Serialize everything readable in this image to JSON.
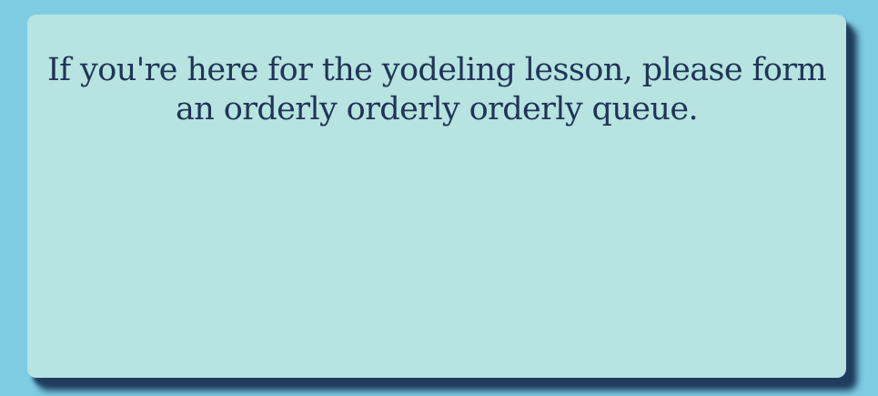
{
  "card": {
    "message": "If you're here for the yodeling lesson, please form an orderly orderly orderly queue."
  },
  "colors": {
    "page_background": "#7ecce3",
    "card_background": "#b7e3e0",
    "text": "#1f3556",
    "shadow": "#1f3c5e"
  }
}
